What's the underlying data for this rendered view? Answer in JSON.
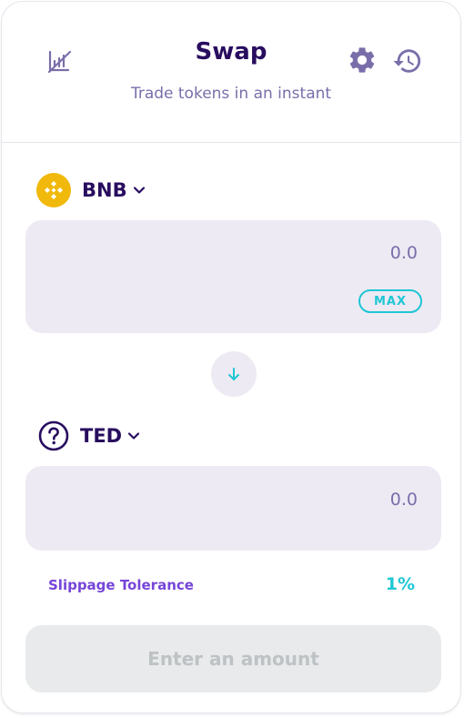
{
  "header": {
    "title": "Swap",
    "subtitle": "Trade tokens in an instant",
    "icons": [
      "chart-disabled-icon",
      "gear-icon",
      "history-icon"
    ]
  },
  "from_token": {
    "symbol": "BNB",
    "icon": "bnb-logo-icon",
    "amount_placeholder": "0.0",
    "max_label": "MAX"
  },
  "switch": {
    "icon": "arrow-down-icon"
  },
  "to_token": {
    "symbol": "TED",
    "icon": "question-circle-icon",
    "amount_placeholder": "0.0"
  },
  "slippage": {
    "label": "Slippage Tolerance",
    "value": "1%"
  },
  "submit": {
    "label": "Enter an amount"
  },
  "colors": {
    "title": "#280d5f",
    "secondary_text": "#7a6eaa",
    "input_bg": "#eeeaf4",
    "accent_cyan": "#1fc7d4",
    "accent_purple": "#7645d9",
    "bnb_yellow": "#f0b90b",
    "disabled_bg": "#e9eaeb",
    "disabled_text": "#bdc2c4"
  }
}
